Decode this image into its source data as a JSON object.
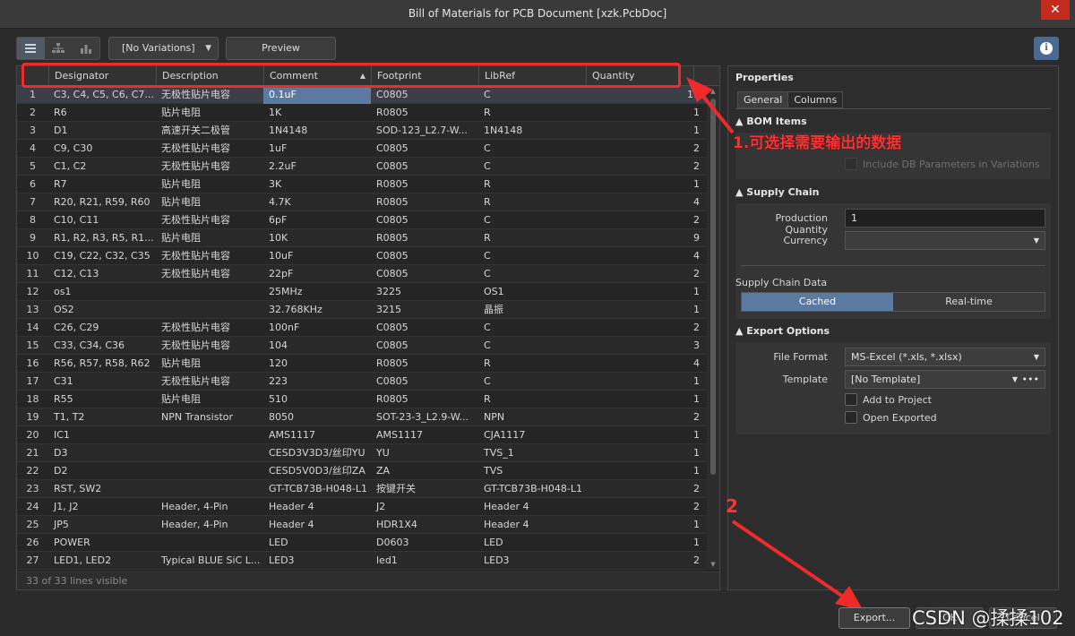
{
  "window": {
    "title": "Bill of Materials for PCB Document [xzk.PcbDoc]",
    "close_icon": "✕"
  },
  "toolbar": {
    "view_icons": [
      "list-view-icon",
      "tree-view-icon",
      "chart-view-icon"
    ],
    "variation_value": "[No Variations]",
    "preview_label": "Preview"
  },
  "grid": {
    "columns": [
      "Designator",
      "Description",
      "Comment",
      "Footprint",
      "LibRef",
      "Quantity"
    ],
    "sort_column": "Comment",
    "selected_cell": {
      "row": 1,
      "column": "Comment"
    },
    "rows": [
      {
        "n": "1",
        "designator": "C3, C4, C5, C6, C7...",
        "description": "无极性贴片电容",
        "comment": "0.1uF",
        "footprint": "C0805",
        "libref": "C",
        "qty": "11"
      },
      {
        "n": "2",
        "designator": "R6",
        "description": "贴片电阻",
        "comment": "1K",
        "footprint": "R0805",
        "libref": "R",
        "qty": "1"
      },
      {
        "n": "3",
        "designator": "D1",
        "description": "高速开关二极管",
        "comment": "1N4148",
        "footprint": "SOD-123_L2.7-W...",
        "libref": "1N4148",
        "qty": "1"
      },
      {
        "n": "4",
        "designator": "C9, C30",
        "description": "无极性贴片电容",
        "comment": "1uF",
        "footprint": "C0805",
        "libref": "C",
        "qty": "2"
      },
      {
        "n": "5",
        "designator": "C1, C2",
        "description": "无极性贴片电容",
        "comment": "2.2uF",
        "footprint": "C0805",
        "libref": "C",
        "qty": "2"
      },
      {
        "n": "6",
        "designator": "R7",
        "description": "贴片电阻",
        "comment": "3K",
        "footprint": "R0805",
        "libref": "R",
        "qty": "1"
      },
      {
        "n": "7",
        "designator": "R20, R21, R59, R60",
        "description": "贴片电阻",
        "comment": "4.7K",
        "footprint": "R0805",
        "libref": "R",
        "qty": "4"
      },
      {
        "n": "8",
        "designator": "C10, C11",
        "description": "无极性贴片电容",
        "comment": "6pF",
        "footprint": "C0805",
        "libref": "C",
        "qty": "2"
      },
      {
        "n": "9",
        "designator": "R1, R2, R3, R5, R1...",
        "description": "贴片电阻",
        "comment": "10K",
        "footprint": "R0805",
        "libref": "R",
        "qty": "9"
      },
      {
        "n": "10",
        "designator": "C19, C22, C32, C35",
        "description": "无极性贴片电容",
        "comment": "10uF",
        "footprint": "C0805",
        "libref": "C",
        "qty": "4"
      },
      {
        "n": "11",
        "designator": "C12, C13",
        "description": "无极性贴片电容",
        "comment": "22pF",
        "footprint": "C0805",
        "libref": "C",
        "qty": "2"
      },
      {
        "n": "12",
        "designator": "os1",
        "description": "",
        "comment": "25MHz",
        "footprint": "3225",
        "libref": "OS1",
        "qty": "1"
      },
      {
        "n": "13",
        "designator": "OS2",
        "description": "",
        "comment": "32.768KHz",
        "footprint": "3215",
        "libref": "晶振",
        "qty": "1"
      },
      {
        "n": "14",
        "designator": "C26, C29",
        "description": "无极性贴片电容",
        "comment": "100nF",
        "footprint": "C0805",
        "libref": "C",
        "qty": "2"
      },
      {
        "n": "15",
        "designator": "C33, C34, C36",
        "description": "无极性贴片电容",
        "comment": "104",
        "footprint": "C0805",
        "libref": "C",
        "qty": "3"
      },
      {
        "n": "16",
        "designator": "R56, R57, R58, R62",
        "description": "贴片电阻",
        "comment": "120",
        "footprint": "R0805",
        "libref": "R",
        "qty": "4"
      },
      {
        "n": "17",
        "designator": "C31",
        "description": "无极性贴片电容",
        "comment": "223",
        "footprint": "C0805",
        "libref": "C",
        "qty": "1"
      },
      {
        "n": "18",
        "designator": "R55",
        "description": "贴片电阻",
        "comment": "510",
        "footprint": "R0805",
        "libref": "R",
        "qty": "1"
      },
      {
        "n": "19",
        "designator": "T1, T2",
        "description": "NPN Transistor",
        "comment": "8050",
        "footprint": "SOT-23-3_L2.9-W...",
        "libref": "NPN",
        "qty": "2"
      },
      {
        "n": "20",
        "designator": "IC1",
        "description": "",
        "comment": "AMS1117",
        "footprint": "AMS1117",
        "libref": "CJA1117",
        "qty": "1"
      },
      {
        "n": "21",
        "designator": "D3",
        "description": "",
        "comment": "CESD3V3D3/丝印YU",
        "footprint": "YU",
        "libref": "TVS_1",
        "qty": "1"
      },
      {
        "n": "22",
        "designator": "D2",
        "description": "",
        "comment": "CESD5V0D3/丝印ZA",
        "footprint": "ZA",
        "libref": "TVS",
        "qty": "1"
      },
      {
        "n": "23",
        "designator": "RST, SW2",
        "description": "",
        "comment": "GT-TCB73B-H048-L1",
        "footprint": "按键开关",
        "libref": "GT-TCB73B-H048-L1",
        "qty": "2"
      },
      {
        "n": "24",
        "designator": "J1, J2",
        "description": "Header, 4-Pin",
        "comment": "Header 4",
        "footprint": "J2",
        "libref": "Header 4",
        "qty": "2"
      },
      {
        "n": "25",
        "designator": "JP5",
        "description": "Header, 4-Pin",
        "comment": "Header 4",
        "footprint": "HDR1X4",
        "libref": "Header 4",
        "qty": "1"
      },
      {
        "n": "26",
        "designator": "POWER",
        "description": "",
        "comment": "LED",
        "footprint": "D0603",
        "libref": "LED",
        "qty": "1"
      },
      {
        "n": "27",
        "designator": "LED1, LED2",
        "description": "Typical BLUE SiC L...",
        "comment": "LED3",
        "footprint": "led1",
        "libref": "LED3",
        "qty": "2"
      }
    ],
    "status": "33 of 33 lines visible"
  },
  "properties": {
    "title": "Properties",
    "tabs": [
      "General",
      "Columns"
    ],
    "bom_items": {
      "heading": "BOM Items",
      "include_db_label": "Include DB Parameters in Variations"
    },
    "supply_chain": {
      "heading": "Supply Chain",
      "production_qty_label": "Production Quantity",
      "production_qty_value": "1",
      "currency_label": "Currency",
      "currency_value": "",
      "data_label": "Supply Chain Data",
      "options": [
        "Cached",
        "Real-time"
      ],
      "selected": "Cached"
    },
    "export_options": {
      "heading": "Export Options",
      "file_format_label": "File Format",
      "file_format_value": "MS-Excel (*.xls, *.xlsx)",
      "template_label": "Template",
      "template_value": "[No Template]",
      "template_more": "•••",
      "add_to_project_label": "Add to Project",
      "open_exported_label": "Open Exported"
    }
  },
  "annotations": {
    "step1": "1.可选择需要输出的数据",
    "step2": "2"
  },
  "footer": {
    "export_label": "Export...",
    "ok_label": "OK",
    "cancel_label": "Cancel"
  },
  "watermark": "CSDN @揉揉102",
  "colors": {
    "selection": "#5b7a9f",
    "annotation": "#ee2a2a",
    "close": "#c42b1c"
  }
}
